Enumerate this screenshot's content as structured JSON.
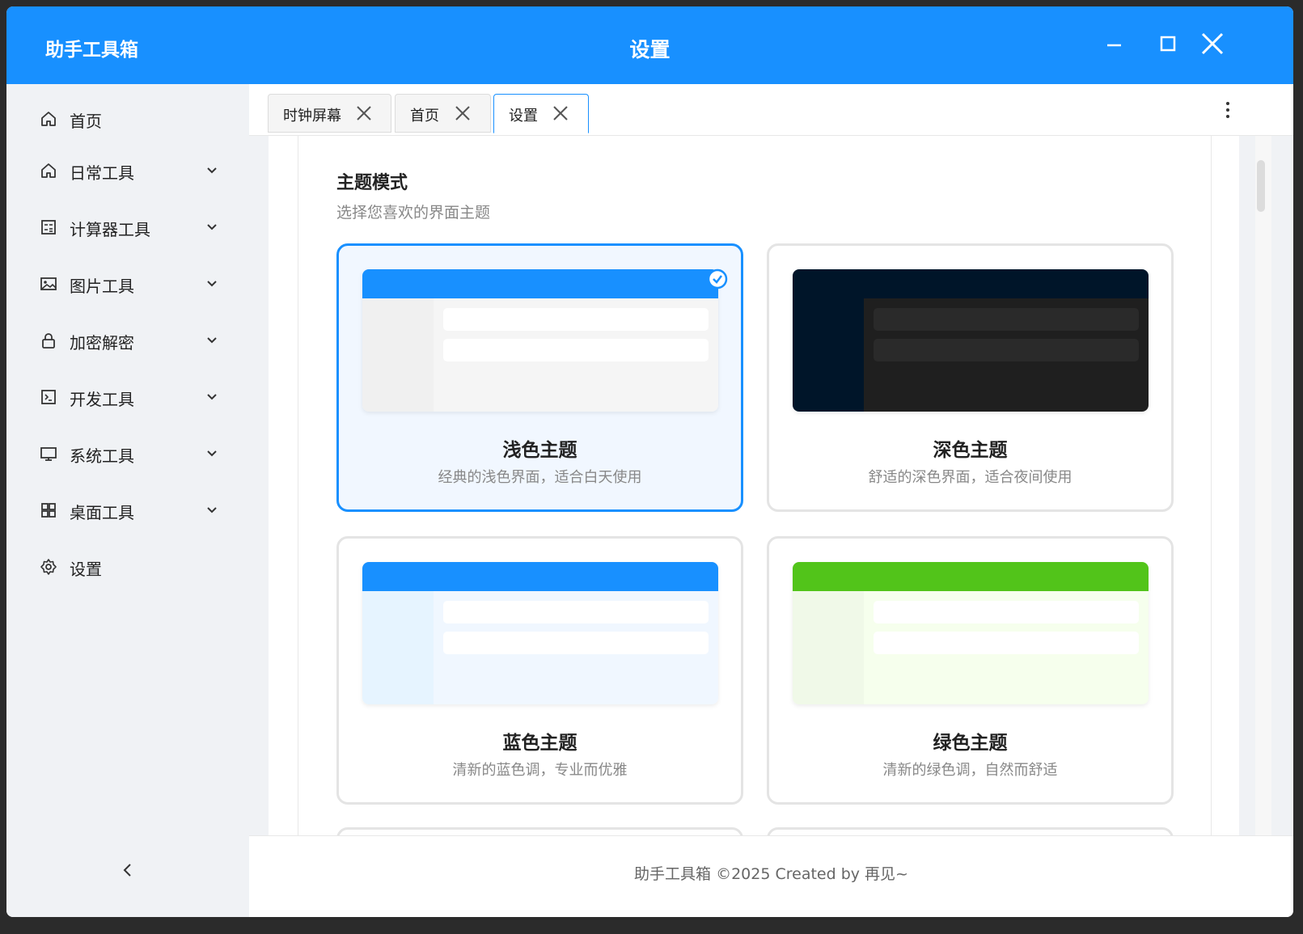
{
  "window": {
    "app_name": "助手工具箱",
    "title": "设置",
    "colors": {
      "titlebar": "#1890ff",
      "sidebar": "#f0f2f5"
    }
  },
  "sidebar": {
    "items": [
      {
        "label": "首页",
        "icon": "home-icon",
        "expandable": false
      },
      {
        "label": "日常工具",
        "icon": "home-icon",
        "expandable": true
      },
      {
        "label": "计算器工具",
        "icon": "calculator-icon",
        "expandable": true
      },
      {
        "label": "图片工具",
        "icon": "image-icon",
        "expandable": true
      },
      {
        "label": "加密解密",
        "icon": "lock-icon",
        "expandable": true
      },
      {
        "label": "开发工具",
        "icon": "terminal-icon",
        "expandable": true
      },
      {
        "label": "系统工具",
        "icon": "monitor-icon",
        "expandable": true
      },
      {
        "label": "桌面工具",
        "icon": "grid-icon",
        "expandable": true
      },
      {
        "label": "设置",
        "icon": "gear-icon",
        "expandable": false
      }
    ]
  },
  "tabs": [
    {
      "label": "时钟屏幕",
      "active": false
    },
    {
      "label": "首页",
      "active": false
    },
    {
      "label": "设置",
      "active": true
    }
  ],
  "section": {
    "title": "主题模式",
    "subtitle": "选择您喜欢的界面主题"
  },
  "themes": [
    {
      "name": "浅色主题",
      "desc": "经典的浅色界面，适合白天使用",
      "selected": true,
      "colors": {
        "head": "#1890ff",
        "side": "#f0f0f0",
        "main": "#f5f5f5",
        "bar": "#ffffff"
      }
    },
    {
      "name": "深色主题",
      "desc": "舒适的深色界面，适合夜间使用",
      "selected": false,
      "colors": {
        "head": "#001529",
        "side": "#001529",
        "main": "#1f1f1f",
        "bar": "#2a2a2a"
      }
    },
    {
      "name": "蓝色主题",
      "desc": "清新的蓝色调，专业而优雅",
      "selected": false,
      "colors": {
        "head": "#1890ff",
        "side": "#e6f4ff",
        "main": "#f0f7ff",
        "bar": "#ffffff"
      }
    },
    {
      "name": "绿色主题",
      "desc": "清新的绿色调，自然而舒适",
      "selected": false,
      "colors": {
        "head": "#52c41a",
        "side": "#f0f9e8",
        "main": "#f6ffed",
        "bar": "#ffffff"
      }
    }
  ],
  "footer": {
    "text": "助手工具箱 ©2025 Created by 再见~"
  }
}
